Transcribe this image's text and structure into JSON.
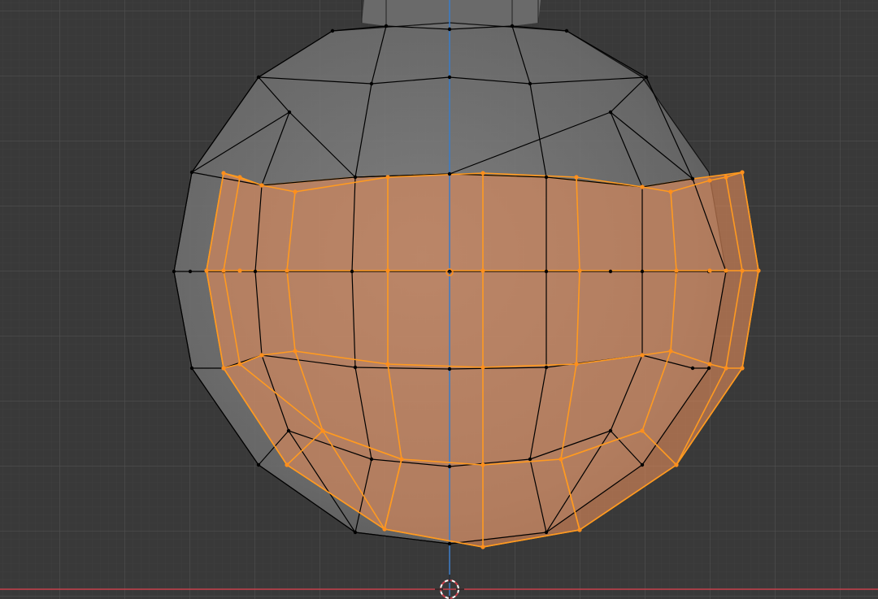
{
  "app": {
    "status_text": ""
  },
  "viewport": {
    "background_color": "#393939",
    "grid_color": "#505050",
    "x_axis_color": "#c8404a",
    "z_axis_color": "#3a7cc8"
  },
  "mesh": {
    "object_shading_color": "#7a7a7a",
    "wire_color": "#000000",
    "selected_wire_color": "#ff9a20",
    "selected_face_color": "#e08a5a",
    "vertex_color": "#000000",
    "selected_vertex_color": "#ff8f1c"
  },
  "icons": {
    "cursor": "3d-cursor-icon",
    "origin": "object-origin-icon"
  }
}
